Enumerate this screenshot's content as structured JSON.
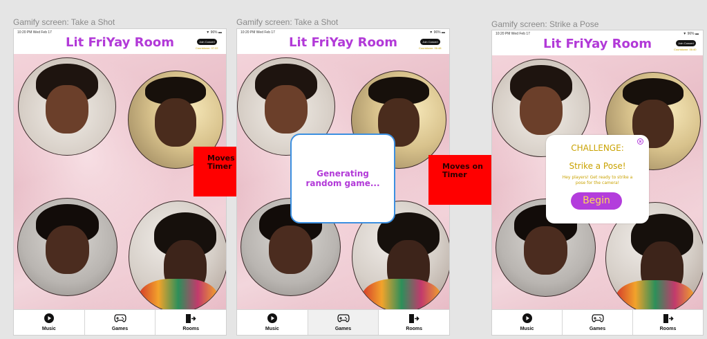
{
  "frames": [
    {
      "label": "Gamify screen: Take a Shot",
      "status_time": "10:20 PM  Wed Feb 17",
      "status_right": "▼ 96% ▬",
      "title": "Lit FriYay Room",
      "concert_button": "Join Concert",
      "countdown": "Countdown: 07:22",
      "tabs": [
        {
          "label": "Music",
          "icon": "play-circle-icon"
        },
        {
          "label": "Games",
          "icon": "gamepad-icon"
        },
        {
          "label": "Rooms",
          "icon": "door-exit-icon"
        }
      ]
    },
    {
      "label": "Gamify screen: Take a Shot",
      "status_time": "10:20 PM  Wed Feb 17",
      "status_right": "▼ 96% ▬",
      "title": "Lit FriYay Room",
      "concert_button": "Join Concert",
      "countdown": "Countdown: 06:48",
      "active_tab": "Games",
      "dialog_text": "Generating random game...",
      "tabs": [
        {
          "label": "Music",
          "icon": "play-circle-icon"
        },
        {
          "label": "Games",
          "icon": "gamepad-icon"
        },
        {
          "label": "Rooms",
          "icon": "door-exit-icon"
        }
      ]
    },
    {
      "label": "Gamify screen: Strike a Pose",
      "status_time": "10:20 PM  Wed Feb 17",
      "status_right": "▼ 96% ▬",
      "title": "Lit FriYay Room",
      "concert_button": "Join Concert",
      "countdown": "Countdown: 06:40",
      "challenge": {
        "heading": "CHALLENGE:",
        "name": "Strike a Pose!",
        "description": "Hey players! Get ready to strike a pose for the camera!",
        "button": "Begin"
      },
      "tabs": [
        {
          "label": "Music",
          "icon": "play-circle-icon"
        },
        {
          "label": "Games",
          "icon": "gamepad-icon"
        },
        {
          "label": "Rooms",
          "icon": "door-exit-icon"
        }
      ]
    }
  ],
  "annotations": [
    "Moves on Timer",
    "Moves on Timer"
  ],
  "colors": {
    "title": "#b23ad8",
    "accent_gold": "#c9a200",
    "annotation_red": "#ff0000",
    "dialog_border": "#3b8fe0",
    "begin_button": "#b33ddc"
  }
}
